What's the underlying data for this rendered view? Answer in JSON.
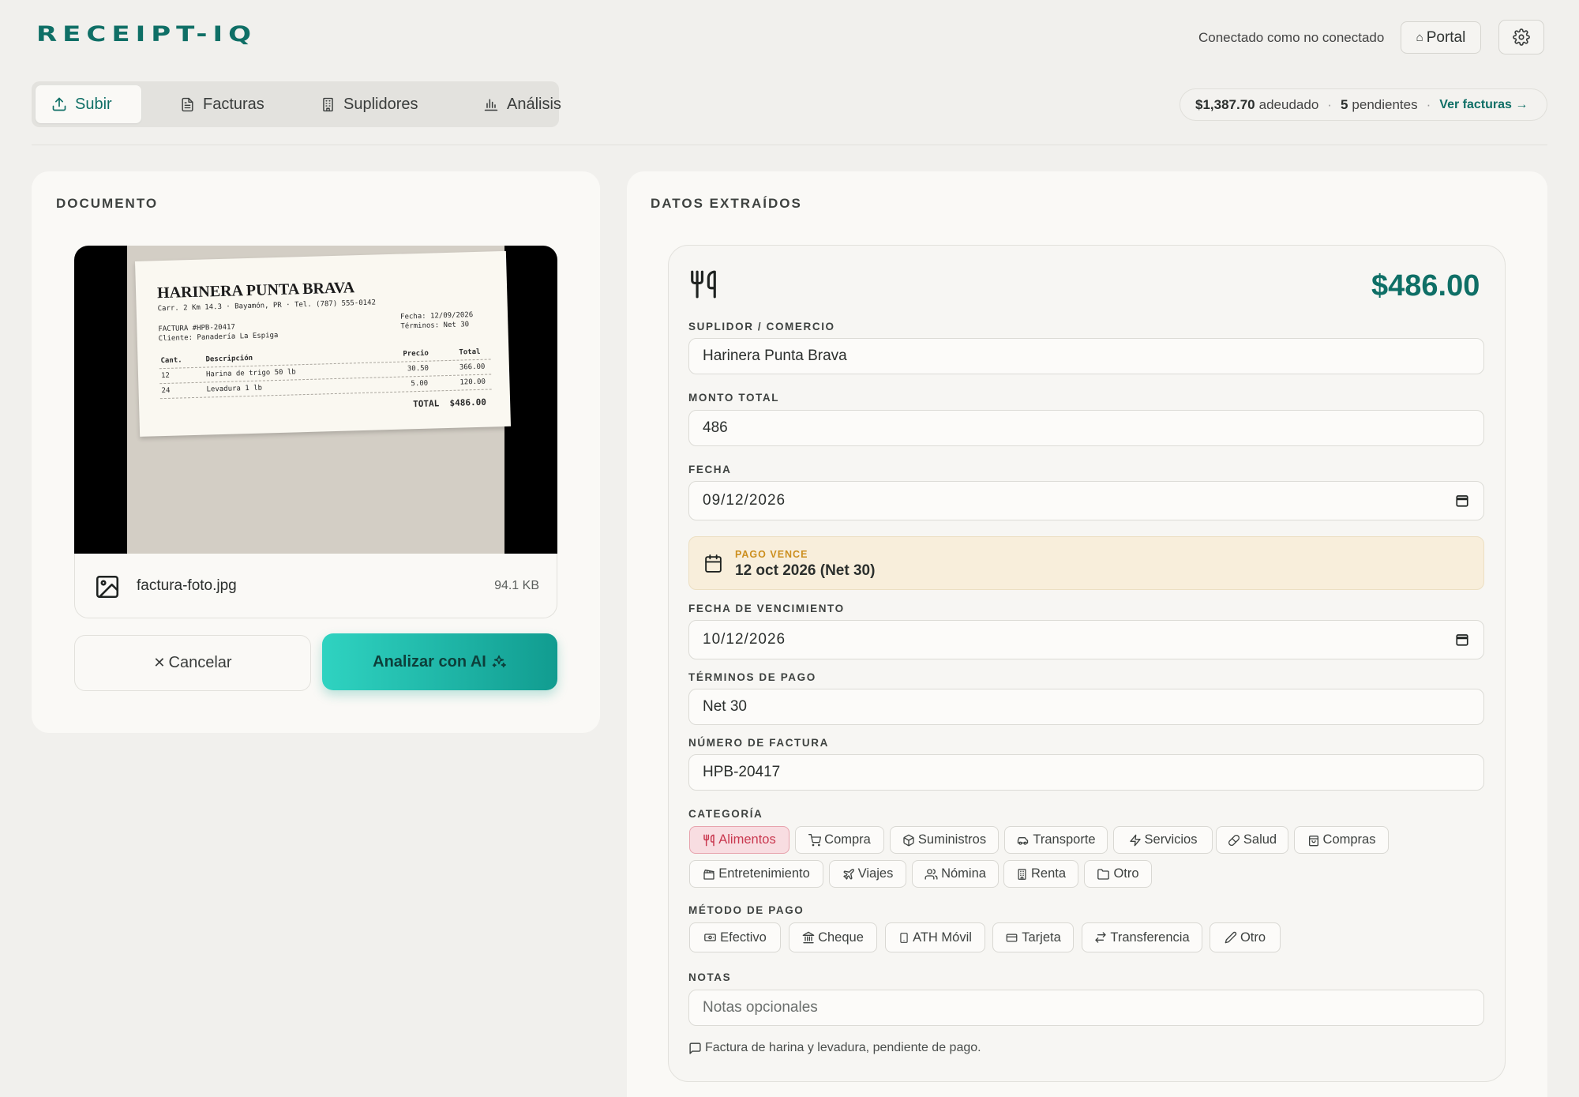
{
  "app": {
    "logo": "RECEIPT-IQ"
  },
  "header": {
    "connection_status": "Conectado como no conectado",
    "portal_label": "Portal"
  },
  "tabs": [
    {
      "label": "Subir",
      "icon": "upload-icon",
      "active": true
    },
    {
      "label": "Facturas",
      "icon": "document-icon",
      "active": false
    },
    {
      "label": "Suplidores",
      "icon": "building-icon",
      "active": false
    },
    {
      "label": "Análisis",
      "icon": "bar-chart-icon",
      "active": false
    }
  ],
  "summary": {
    "owed": "$1,387.70",
    "owed_label": "adeudado",
    "pending_count": "5",
    "pending_label": "pendientes",
    "link_label": "Ver facturas →"
  },
  "document": {
    "section_title": "DOCUMENTO",
    "receipt": {
      "business_name": "HARINERA PUNTA BRAVA",
      "address_line": "Carr. 2 Km 14.3 · Bayamón, PR · Tel. (787) 555-0142",
      "invoice_line": "FACTURA #HPB-20417",
      "client_line": "Cliente: Panadería La Espiga",
      "date_line": "Fecha: 12/09/2026",
      "terms_line": "Términos: Net 30",
      "headers": {
        "qty": "Cant.",
        "desc": "Descripción",
        "price": "Precio",
        "total": "Total"
      },
      "rows": [
        {
          "qty": "12",
          "desc": "Harina de trigo 50 lb",
          "price": "30.50",
          "total": "366.00"
        },
        {
          "qty": "24",
          "desc": "Levadura 1 lb",
          "price": "5.00",
          "total": "120.00"
        }
      ],
      "total_line": "TOTAL  $486.00"
    },
    "file_name": "factura-foto.jpg",
    "file_size": "94.1 KB",
    "cancel_label": "Cancelar",
    "analyze_label": "Analizar con AI"
  },
  "extracted": {
    "section_title": "DATOS EXTRAÍDOS",
    "amount_display": "$486.00",
    "supplier": {
      "label": "SUPLIDOR / COMERCIO",
      "value": "Harinera Punta Brava"
    },
    "total": {
      "label": "MONTO TOTAL",
      "value": "486"
    },
    "date": {
      "label": "FECHA",
      "value": "09/12/2026"
    },
    "due_notice": {
      "label": "PAGO VENCE",
      "value": "12 oct 2026 (Net 30)"
    },
    "due_date": {
      "label": "FECHA DE VENCIMIENTO",
      "value": "10/12/2026"
    },
    "terms": {
      "label": "TÉRMINOS DE PAGO",
      "value": "Net 30"
    },
    "invoice_number": {
      "label": "NÚMERO DE FACTURA",
      "value": "HPB-20417"
    },
    "category": {
      "label": "CATEGORÍA",
      "options": [
        {
          "label": "Alimentos",
          "icon": "utensils-icon",
          "selected": true
        },
        {
          "label": "Compra",
          "icon": "cart-icon",
          "selected": false
        },
        {
          "label": "Suministros",
          "icon": "box-icon",
          "selected": false
        },
        {
          "label": "Transporte",
          "icon": "car-icon",
          "selected": false
        },
        {
          "label": "Servicios",
          "icon": "bolt-icon",
          "selected": false
        },
        {
          "label": "Salud",
          "icon": "pill-icon",
          "selected": false
        },
        {
          "label": "Compras",
          "icon": "bag-icon",
          "selected": false
        },
        {
          "label": "Entretenimiento",
          "icon": "clapper-icon",
          "selected": false
        },
        {
          "label": "Viajes",
          "icon": "plane-icon",
          "selected": false
        },
        {
          "label": "Nómina",
          "icon": "users-icon",
          "selected": false
        },
        {
          "label": "Renta",
          "icon": "building-icon",
          "selected": false
        },
        {
          "label": "Otro",
          "icon": "folder-icon",
          "selected": false
        }
      ]
    },
    "payment_method": {
      "label": "MÉTODO DE PAGO",
      "options": [
        {
          "label": "Efectivo",
          "icon": "cash-icon"
        },
        {
          "label": "Cheque",
          "icon": "bank-icon"
        },
        {
          "label": "ATH Móvil",
          "icon": "phone-icon"
        },
        {
          "label": "Tarjeta",
          "icon": "card-icon"
        },
        {
          "label": "Transferencia",
          "icon": "transfer-icon"
        },
        {
          "label": "Otro",
          "icon": "pencil-icon"
        }
      ]
    },
    "notes": {
      "label": "NOTAS",
      "placeholder": "Notas opcionales"
    },
    "ai_note": "Factura de harina y levadura, pendiente de pago."
  },
  "colors": {
    "brand": "#0f6f66",
    "accent_start": "#2fd3c1",
    "accent_end": "#119c90",
    "selected_chip": "#c9384f",
    "due_label": "#cc8f1f"
  }
}
